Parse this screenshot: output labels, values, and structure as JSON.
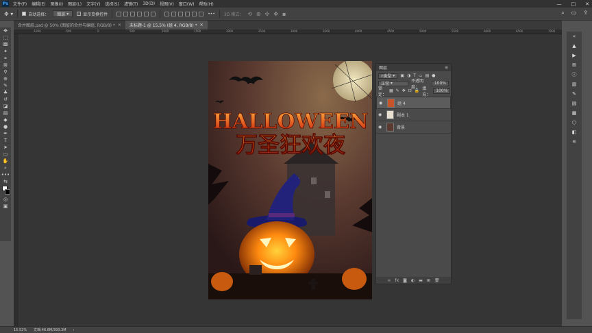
{
  "menubar": {
    "logo": "Ps",
    "items": [
      "文件(F)",
      "编辑(E)",
      "图像(I)",
      "图层(L)",
      "文字(Y)",
      "选择(S)",
      "滤镜(T)",
      "3D(D)",
      "视图(V)",
      "窗口(W)",
      "帮助(H)"
    ],
    "window_buttons": [
      "—",
      "□",
      "✕"
    ]
  },
  "options": {
    "auto_select_label": "自动选择：",
    "auto_select_value": "图层",
    "show_transform_label": "显示变换控件",
    "mode_3d_label": "3D 模式："
  },
  "tabs": [
    {
      "label": "合并图层.psd @ 50% (图层的合并与编组, RGB/8) *",
      "close": "×"
    },
    {
      "label": "未标题-1 @ 15.5% (组 4, RGB/8) *",
      "close": "×"
    }
  ],
  "ruler_numbers": [
    "-1000",
    "-500",
    "0",
    "500",
    "1000",
    "1500",
    "2000",
    "2500",
    "3000",
    "3500",
    "4000",
    "4500",
    "5000",
    "5500",
    "6000",
    "6500",
    "7000"
  ],
  "poster": {
    "title_en": "HALLOWEEN",
    "title_cn": "万圣狂欢夜"
  },
  "layers_panel": {
    "title": "图层",
    "filter_label": "类型",
    "blend_mode": "正常",
    "opacity_label": "不透明度：",
    "opacity_value": "100%",
    "lock_label": "锁定：",
    "fill_label": "填充：",
    "fill_value": "100%",
    "layers": [
      {
        "name": "组 4",
        "selected": true
      },
      {
        "name": "副本 1",
        "selected": false
      },
      {
        "name": "背景",
        "selected": false
      }
    ],
    "footer_icons": [
      "link-icon",
      "fx-icon",
      "mask-icon",
      "adjustment-icon",
      "folder-icon",
      "new-layer-icon",
      "trash-icon"
    ]
  },
  "status": {
    "zoom": "15.52%",
    "doc_info": "文档:46.8M/393.3M"
  },
  "colors": {
    "accent": "#4aa8ff",
    "panel": "#424242",
    "canvas_bg": "#353535"
  }
}
